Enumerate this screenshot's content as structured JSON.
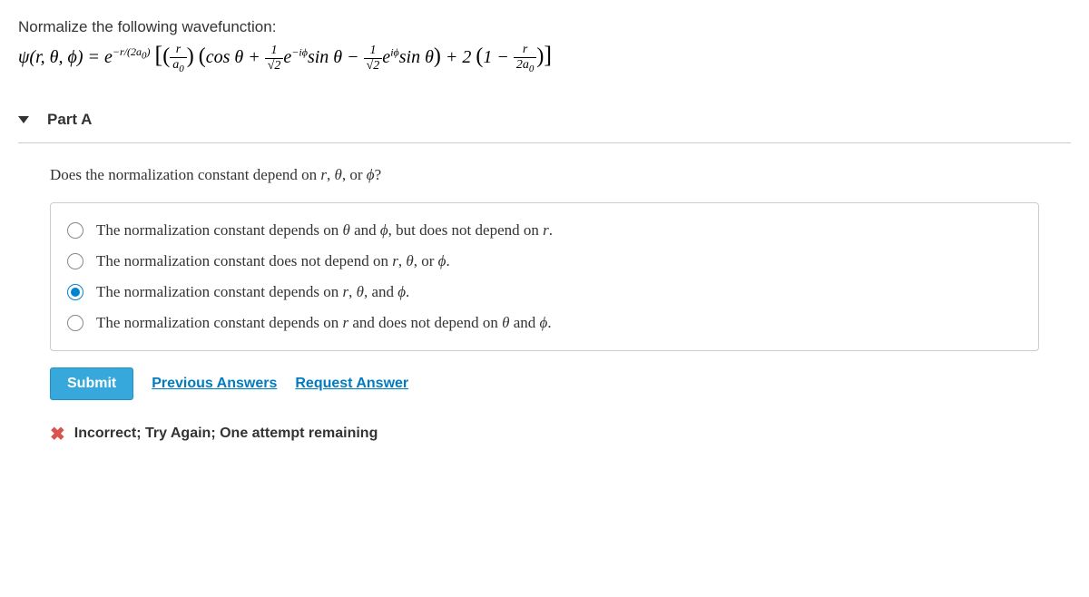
{
  "problem": {
    "instruction": "Normalize the following wavefunction:"
  },
  "part": {
    "title": "Part A",
    "question_prefix": "Does the normalization constant depend on ",
    "question_suffix": "?"
  },
  "options": [
    {
      "pre": "The normalization constant depends on ",
      "mid1": "θ",
      "and": " and ",
      "mid2": "ϕ",
      "post": ", but does not depend on ",
      "mid3": "r",
      "end": ".",
      "selected": false
    },
    {
      "pre": "The normalization constant does not depend on ",
      "mid1": "r",
      "c1": ", ",
      "mid2": "θ",
      "c2": ", or ",
      "mid3": "ϕ",
      "end": ".",
      "selected": false
    },
    {
      "pre": "The normalization constant depends on ",
      "mid1": "r",
      "c1": ", ",
      "mid2": "θ",
      "c2": ", and ",
      "mid3": "ϕ",
      "end": ".",
      "selected": true
    },
    {
      "pre": "The normalization constant depends on ",
      "mid1": "r",
      "post": " and does not depend on ",
      "mid2": "θ",
      "and": " and ",
      "mid3": "ϕ",
      "end": ".",
      "selected": false
    }
  ],
  "actions": {
    "submit": "Submit",
    "previous": "Previous Answers",
    "request": "Request Answer"
  },
  "feedback": {
    "text": "Incorrect; Try Again; One attempt remaining"
  }
}
